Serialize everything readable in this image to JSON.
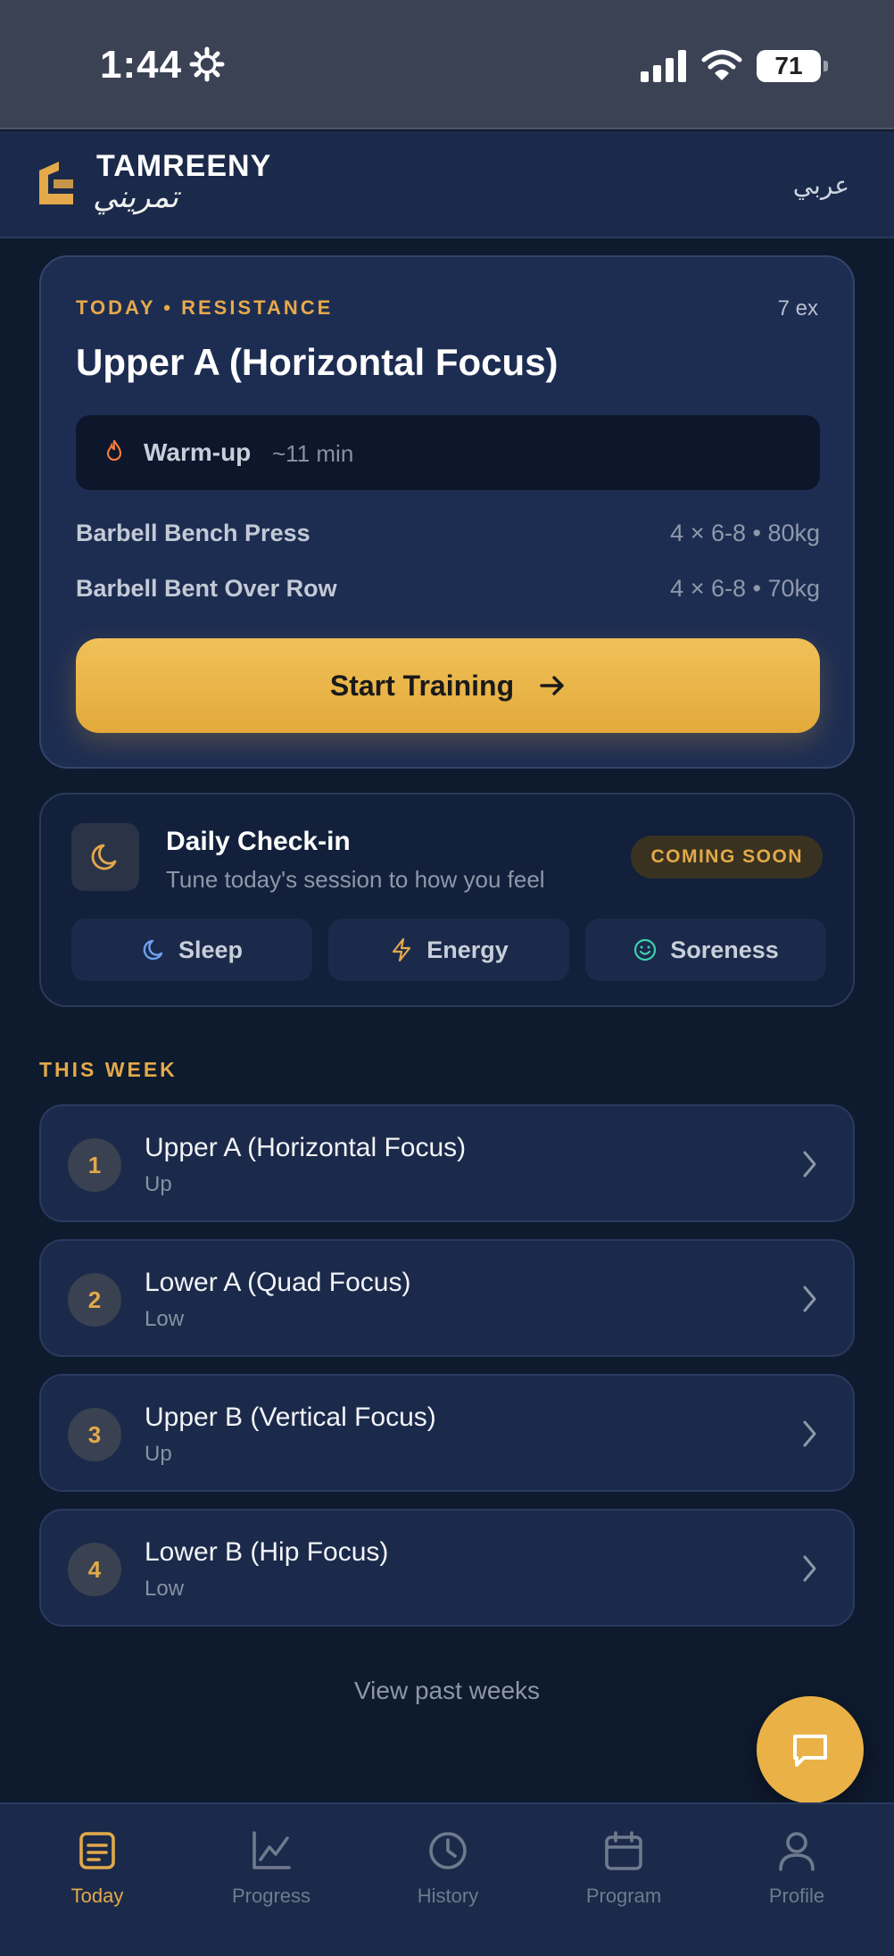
{
  "status_bar": {
    "time": "1:44",
    "battery": "71"
  },
  "header": {
    "brand": "TAMREENY",
    "brand_arabic": "تمريني",
    "language_toggle": "عربي"
  },
  "today_card": {
    "tag": "TODAY • RESISTANCE",
    "exercise_count": "7 ex",
    "title": "Upper A (Horizontal Focus)",
    "warmup": {
      "label": "Warm-up",
      "duration": "~11 min"
    },
    "exercises": [
      {
        "name": "Barbell Bench Press",
        "detail": "4 × 6-8 • 80kg"
      },
      {
        "name": "Barbell Bent Over Row",
        "detail": "4 × 6-8 • 70kg"
      }
    ],
    "start_label": "Start Training"
  },
  "checkin": {
    "title": "Daily Check-in",
    "subtitle": "Tune today's session to how you feel",
    "badge": "COMING SOON",
    "metrics": [
      {
        "label": "Sleep",
        "icon": "moon-icon"
      },
      {
        "label": "Energy",
        "icon": "bolt-icon"
      },
      {
        "label": "Soreness",
        "icon": "smile-icon"
      }
    ]
  },
  "this_week": {
    "heading": "THIS WEEK",
    "days": [
      {
        "num": "1",
        "name": "Upper A (Horizontal Focus)",
        "sub": "Up"
      },
      {
        "num": "2",
        "name": "Lower A (Quad Focus)",
        "sub": "Low"
      },
      {
        "num": "3",
        "name": "Upper B (Vertical Focus)",
        "sub": "Up"
      },
      {
        "num": "4",
        "name": "Lower B (Hip Focus)",
        "sub": "Low"
      }
    ],
    "past_weeks": "View past weeks"
  },
  "tabs": [
    {
      "label": "Today",
      "icon": "today-icon",
      "active": true
    },
    {
      "label": "Progress",
      "icon": "chart-icon",
      "active": false
    },
    {
      "label": "History",
      "icon": "clock-icon",
      "active": false
    },
    {
      "label": "Program",
      "icon": "calendar-icon",
      "active": false
    },
    {
      "label": "Profile",
      "icon": "person-icon",
      "active": false
    }
  ],
  "colors": {
    "accent": "#e3a94a",
    "background": "#0e1a2e",
    "card": "#1b2a4a"
  }
}
